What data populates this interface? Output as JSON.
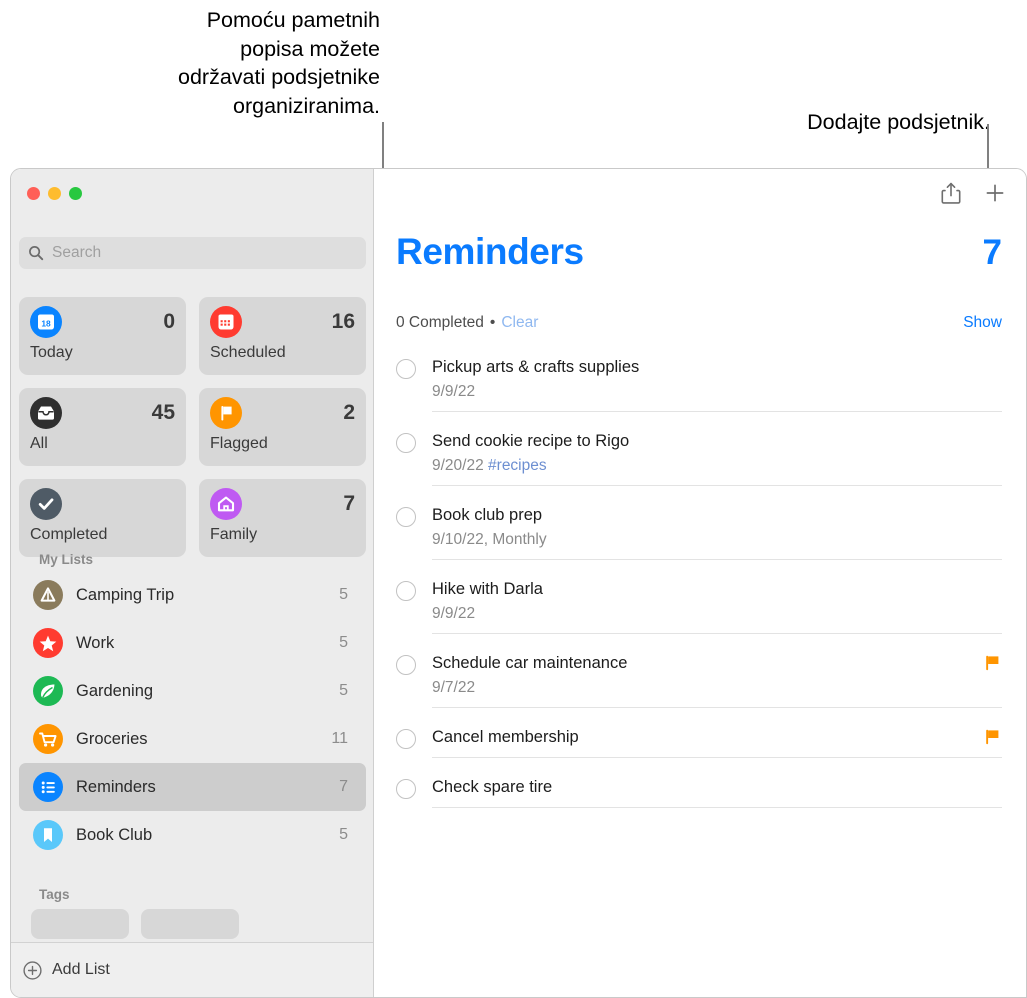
{
  "callouts": {
    "left": "Pomoću pametnih\npopisa možete\nodržavati podsjetnike\norganiziranima.",
    "right": "Dodajte podsjetnik."
  },
  "window": {
    "traffic_lights": {
      "close_label": "close-window",
      "minimize_label": "minimize-window",
      "maximize_label": "maximize-window",
      "close_color": "#ff5f57",
      "minimize_color": "#febc2e",
      "maximize_color": "#28c840"
    }
  },
  "sidebar": {
    "search": {
      "placeholder": "Search",
      "value": "",
      "icon": "search-icon"
    },
    "smart_lists": [
      {
        "label": "Today",
        "count": "0",
        "icon": "calendar-18-icon",
        "color": "#0a84ff"
      },
      {
        "label": "Scheduled",
        "count": "16",
        "icon": "calendar-grid-icon",
        "color": "#ff3b30"
      },
      {
        "label": "All",
        "count": "45",
        "icon": "inbox-tray-icon",
        "color": "#2f2f2f"
      },
      {
        "label": "Flagged",
        "count": "2",
        "icon": "flag-icon",
        "color": "#ff9500"
      },
      {
        "label": "Completed",
        "count": "",
        "icon": "checkmark-icon",
        "color": "#4f5b66"
      },
      {
        "label": "Family",
        "count": "7",
        "icon": "house-icon",
        "color": "#bf5af2"
      }
    ],
    "my_lists_header": "My Lists",
    "my_lists": [
      {
        "label": "Camping Trip",
        "count": "5",
        "icon": "tent-icon",
        "color": "#8a7b5c",
        "selected": false
      },
      {
        "label": "Work",
        "count": "5",
        "icon": "star-icon",
        "color": "#ff3b30",
        "selected": false
      },
      {
        "label": "Gardening",
        "count": "5",
        "icon": "leaf-icon",
        "color": "#1db954",
        "selected": false
      },
      {
        "label": "Groceries",
        "count": "11",
        "icon": "cart-icon",
        "color": "#ff9500",
        "selected": false
      },
      {
        "label": "Reminders",
        "count": "7",
        "icon": "list-bullet-icon",
        "color": "#0a84ff",
        "selected": true
      },
      {
        "label": "Book Club",
        "count": "5",
        "icon": "bookmark-icon",
        "color": "#5ac8fa",
        "selected": false
      }
    ],
    "tags_header": "Tags",
    "tags": [
      {
        "label": ""
      },
      {
        "label": ""
      }
    ],
    "add_list": {
      "label": "Add List",
      "icon": "plus-circle-icon"
    }
  },
  "main": {
    "toolbar": [
      {
        "name": "share-icon",
        "label": "Share"
      },
      {
        "name": "add-reminder-icon",
        "label": "Add Reminder"
      }
    ],
    "title": "Reminders",
    "count": "7",
    "completed_text": "0 Completed",
    "bullet": "•",
    "clear_label": "Clear",
    "show_label": "Show",
    "title_color": "#0a7bff",
    "reminders": [
      {
        "title": "Pickup arts & crafts supplies",
        "sub": "9/9/22",
        "tag": "",
        "flagged": false
      },
      {
        "title": "Send cookie recipe to Rigo",
        "sub": "9/20/22 ",
        "tag": "#recipes",
        "flagged": false
      },
      {
        "title": "Book club prep",
        "sub": "9/10/22, Monthly",
        "tag": "",
        "flagged": false
      },
      {
        "title": "Hike with Darla",
        "sub": "9/9/22",
        "tag": "",
        "flagged": false
      },
      {
        "title": "Schedule car maintenance",
        "sub": "9/7/22",
        "tag": "",
        "flagged": true
      },
      {
        "title": "Cancel membership",
        "sub": "",
        "tag": "",
        "flagged": true
      },
      {
        "title": "Check spare tire",
        "sub": "",
        "tag": "",
        "flagged": false
      }
    ]
  }
}
